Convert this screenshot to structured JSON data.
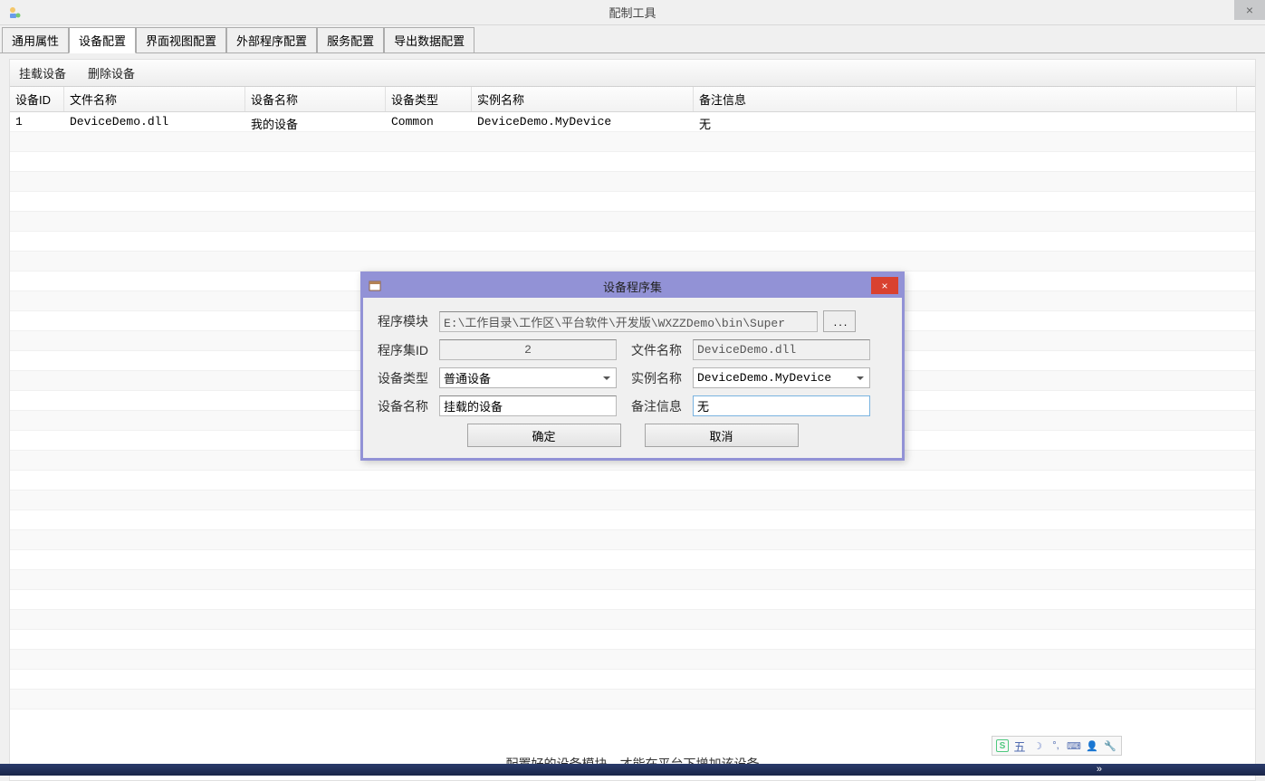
{
  "window": {
    "title": "配制工具",
    "close_label": "×"
  },
  "tabs": [
    {
      "label": "通用属性",
      "active": false
    },
    {
      "label": "设备配置",
      "active": true
    },
    {
      "label": "界面视图配置",
      "active": false
    },
    {
      "label": "外部程序配置",
      "active": false
    },
    {
      "label": "服务配置",
      "active": false
    },
    {
      "label": "导出数据配置",
      "active": false
    }
  ],
  "toolbar": {
    "mount": "挂载设备",
    "delete": "删除设备"
  },
  "table": {
    "headers": {
      "id": "设备ID",
      "file": "文件名称",
      "devname": "设备名称",
      "devtype": "设备类型",
      "instance": "实例名称",
      "remark": "备注信息"
    },
    "rows": [
      {
        "id": "1",
        "file": "DeviceDemo.dll",
        "devname": "我的设备",
        "devtype": "Common",
        "instance": "DeviceDemo.MyDevice",
        "remark": "无"
      }
    ]
  },
  "footer_hint": "配置好的设备模块，才能在平台下增加该设备",
  "dialog": {
    "title": "设备程序集",
    "close_label": "×",
    "labels": {
      "module": "程序模块",
      "assembly_id": "程序集ID",
      "file_name": "文件名称",
      "device_type": "设备类型",
      "instance_name": "实例名称",
      "device_name": "设备名称",
      "remark": "备注信息"
    },
    "values": {
      "module": "E:\\工作目录\\工作区\\平台软件\\开发版\\WXZZDemo\\bin\\Super",
      "assembly_id": "2",
      "file_name": "DeviceDemo.dll",
      "device_type": "普通设备",
      "instance_name": "DeviceDemo.MyDevice",
      "device_name": "挂载的设备",
      "remark": "无"
    },
    "browse_btn": "...",
    "ok_btn": "确定",
    "cancel_btn": "取消"
  },
  "ime": {
    "wu": "五"
  }
}
